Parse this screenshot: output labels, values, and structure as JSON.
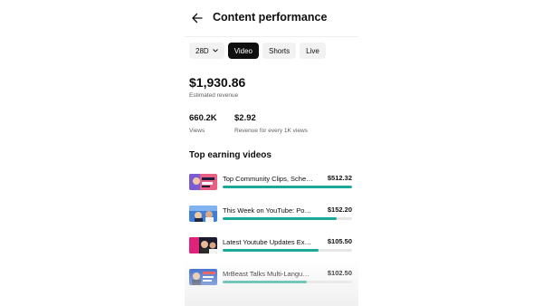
{
  "header": {
    "title": "Content performance"
  },
  "filters": [
    {
      "label": "28D",
      "active": false,
      "dropdown": true
    },
    {
      "label": "Video",
      "active": true,
      "dropdown": false
    },
    {
      "label": "Shorts",
      "active": false,
      "dropdown": false
    },
    {
      "label": "Live",
      "active": false,
      "dropdown": false
    }
  ],
  "summary": {
    "revenue": {
      "value": "$1,930.86",
      "label": "Estimated revenue"
    },
    "views": {
      "value": "660.2K",
      "label": "Views"
    },
    "rpm": {
      "value": "$2.92",
      "label": "Revenue for every 1K views"
    }
  },
  "top_videos": {
    "title": "Top earning videos",
    "items": [
      {
        "title": "Top Community Clips, Sche…",
        "revenue": "$512.32",
        "share": 1.0
      },
      {
        "title": "This Week on YouTube: Po…",
        "revenue": "$152.20",
        "share": 0.88
      },
      {
        "title": "Latest Youtube Updates Ex…",
        "revenue": "$105.50",
        "share": 0.74
      },
      {
        "title": "MrBeast Talks Multi-Langu…",
        "revenue": "$102.50",
        "share": 0.65
      }
    ]
  },
  "colors": {
    "accent": "#1aa997",
    "chip_active": "#0f0f0f",
    "chip_bg": "#f2f2f2"
  },
  "icons": {
    "back": "arrow-left-icon",
    "dropdown": "chevron-down-icon"
  }
}
